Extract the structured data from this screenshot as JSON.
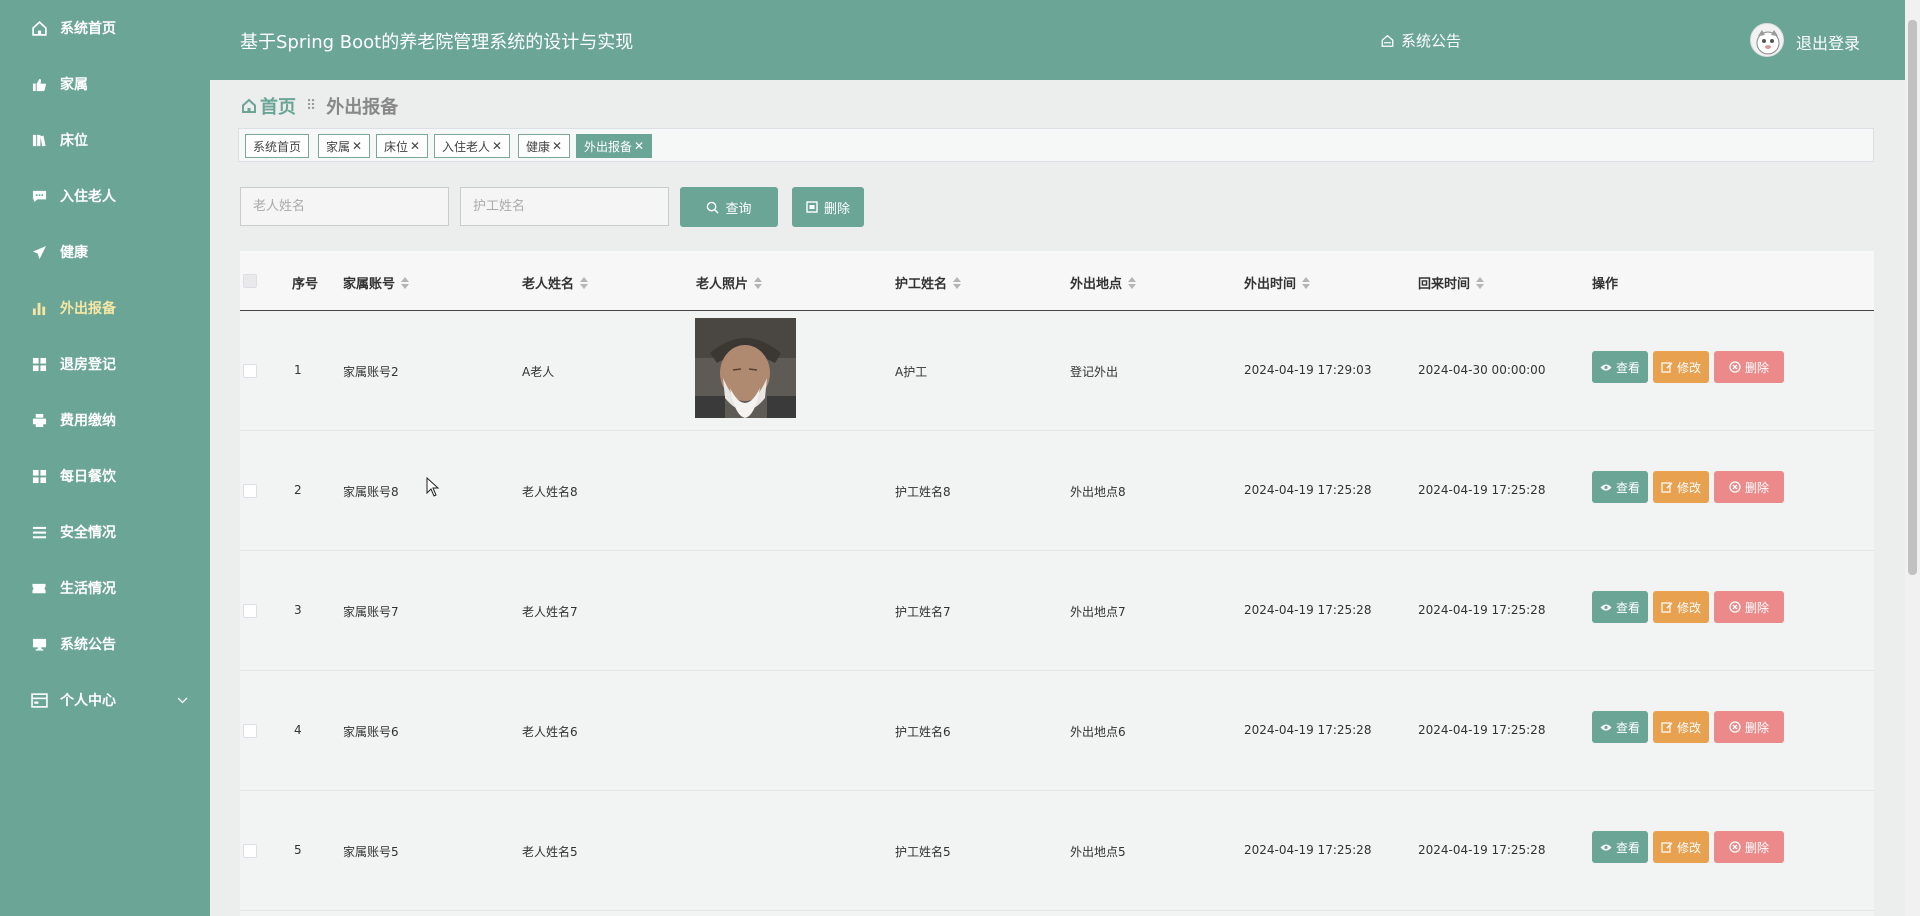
{
  "header": {
    "title": "基于Spring Boot的养老院管理系统的设计与实现",
    "notice_label": "系统公告",
    "logout_label": "退出登录"
  },
  "sidebar": {
    "items": [
      {
        "label": "系统首页",
        "icon": "home-icon"
      },
      {
        "label": "家属",
        "icon": "thumbs-up-icon"
      },
      {
        "label": "床位",
        "icon": "books-icon"
      },
      {
        "label": "入住老人",
        "icon": "chat-icon"
      },
      {
        "label": "健康",
        "icon": "paper-plane-icon"
      },
      {
        "label": "外出报备",
        "icon": "bar-chart-icon",
        "active": true
      },
      {
        "label": "退房登记",
        "icon": "grid-icon"
      },
      {
        "label": "费用缴纳",
        "icon": "printer-icon"
      },
      {
        "label": "每日餐饮",
        "icon": "grid-icon"
      },
      {
        "label": "安全情况",
        "icon": "list-icon"
      },
      {
        "label": "生活情况",
        "icon": "ticket-icon"
      },
      {
        "label": "系统公告",
        "icon": "monitor-icon"
      },
      {
        "label": "个人中心",
        "icon": "id-card-icon"
      }
    ]
  },
  "breadcrumb": {
    "home": "首页",
    "current": "外出报备"
  },
  "tags": [
    {
      "label": "系统首页",
      "closable": false
    },
    {
      "label": "家属",
      "closable": true
    },
    {
      "label": "床位",
      "closable": true
    },
    {
      "label": "入住老人",
      "closable": true
    },
    {
      "label": "健康",
      "closable": true
    },
    {
      "label": "外出报备",
      "closable": true,
      "active": true
    }
  ],
  "search": {
    "elder_placeholder": "老人姓名",
    "nurse_placeholder": "护工姓名",
    "query_label": "查询",
    "delete_label": "删除"
  },
  "table": {
    "columns": [
      "序号",
      "家属账号",
      "老人姓名",
      "老人照片",
      "护工姓名",
      "外出地点",
      "外出时间",
      "回来时间",
      "操作"
    ],
    "actions": {
      "view": "查看",
      "edit": "修改",
      "delete": "删除"
    },
    "rows": [
      {
        "index": "1",
        "account": "家属账号2",
        "elder": "A老人",
        "photo": true,
        "nurse": "A护工",
        "place": "登记外出",
        "out_time": "2024-04-19 17:29:03",
        "back_time": "2024-04-30 00:00:00"
      },
      {
        "index": "2",
        "account": "家属账号8",
        "elder": "老人姓名8",
        "photo": false,
        "nurse": "护工姓名8",
        "place": "外出地点8",
        "out_time": "2024-04-19 17:25:28",
        "back_time": "2024-04-19 17:25:28"
      },
      {
        "index": "3",
        "account": "家属账号7",
        "elder": "老人姓名7",
        "photo": false,
        "nurse": "护工姓名7",
        "place": "外出地点7",
        "out_time": "2024-04-19 17:25:28",
        "back_time": "2024-04-19 17:25:28"
      },
      {
        "index": "4",
        "account": "家属账号6",
        "elder": "老人姓名6",
        "photo": false,
        "nurse": "护工姓名6",
        "place": "外出地点6",
        "out_time": "2024-04-19 17:25:28",
        "back_time": "2024-04-19 17:25:28"
      },
      {
        "index": "5",
        "account": "家属账号5",
        "elder": "老人姓名5",
        "photo": false,
        "nurse": "护工姓名5",
        "place": "外出地点5",
        "out_time": "2024-04-19 17:25:28",
        "back_time": "2024-04-19 17:25:28"
      }
    ]
  },
  "colors": {
    "primary": "#6aa596",
    "edit": "#e8a24f",
    "delete": "#ec8a8a",
    "active_menu": "#f6e7a5"
  }
}
